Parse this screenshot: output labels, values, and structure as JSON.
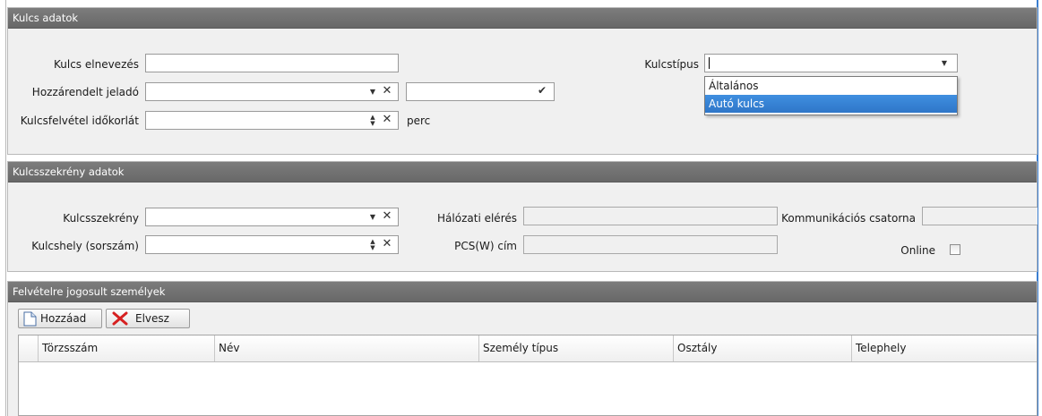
{
  "sections": {
    "key_data": {
      "title": "Kulcs adatok"
    },
    "cabinet_data": {
      "title": "Kulcsszekrény adatok"
    },
    "persons": {
      "title": "Felvételre jogosult személyek"
    }
  },
  "key_form": {
    "name_label": "Kulcs elnevezés",
    "name_value": "",
    "transmitter_label": "Hozzárendelt jeladó",
    "transmitter_value": "",
    "transmitter_extra_value": "",
    "time_limit_label": "Kulcsfelvétel időkorlát",
    "time_limit_value": "",
    "time_limit_unit": "perc",
    "type_label": "Kulcstípus",
    "type_value": "",
    "type_options": [
      "Általános",
      "Autó kulcs"
    ],
    "type_highlighted": "Autó kulcs"
  },
  "cabinet_form": {
    "cabinet_label": "Kulcsszekrény",
    "cabinet_value": "",
    "slot_label": "Kulcshely (sorszám)",
    "slot_value": "",
    "network_label": "Hálózati elérés",
    "network_value": "",
    "pcs_label": "PCS(W) cím",
    "pcs_value": "",
    "channel_label": "Kommunikációs csatorna",
    "channel_value": "",
    "online_label": "Online",
    "online_checked": false
  },
  "toolbar": {
    "add_label": "Hozzáad",
    "remove_label": "Elvesz"
  },
  "grid": {
    "columns": [
      "Törzsszám",
      "Név",
      "Személy típus",
      "Osztály",
      "Telephely"
    ],
    "rows": []
  },
  "icons": {
    "combo": "chevron-down-icon",
    "clear": "close-icon",
    "confirm": "checkmark-icon",
    "spinner": "spinner-arrows-icon",
    "add": "new-document-icon",
    "remove": "red-x-icon"
  },
  "colors": {
    "section_header": "#747474",
    "selection": "#3584d8",
    "window_border": "#3c7fd1",
    "remove_icon": "#d62020"
  }
}
